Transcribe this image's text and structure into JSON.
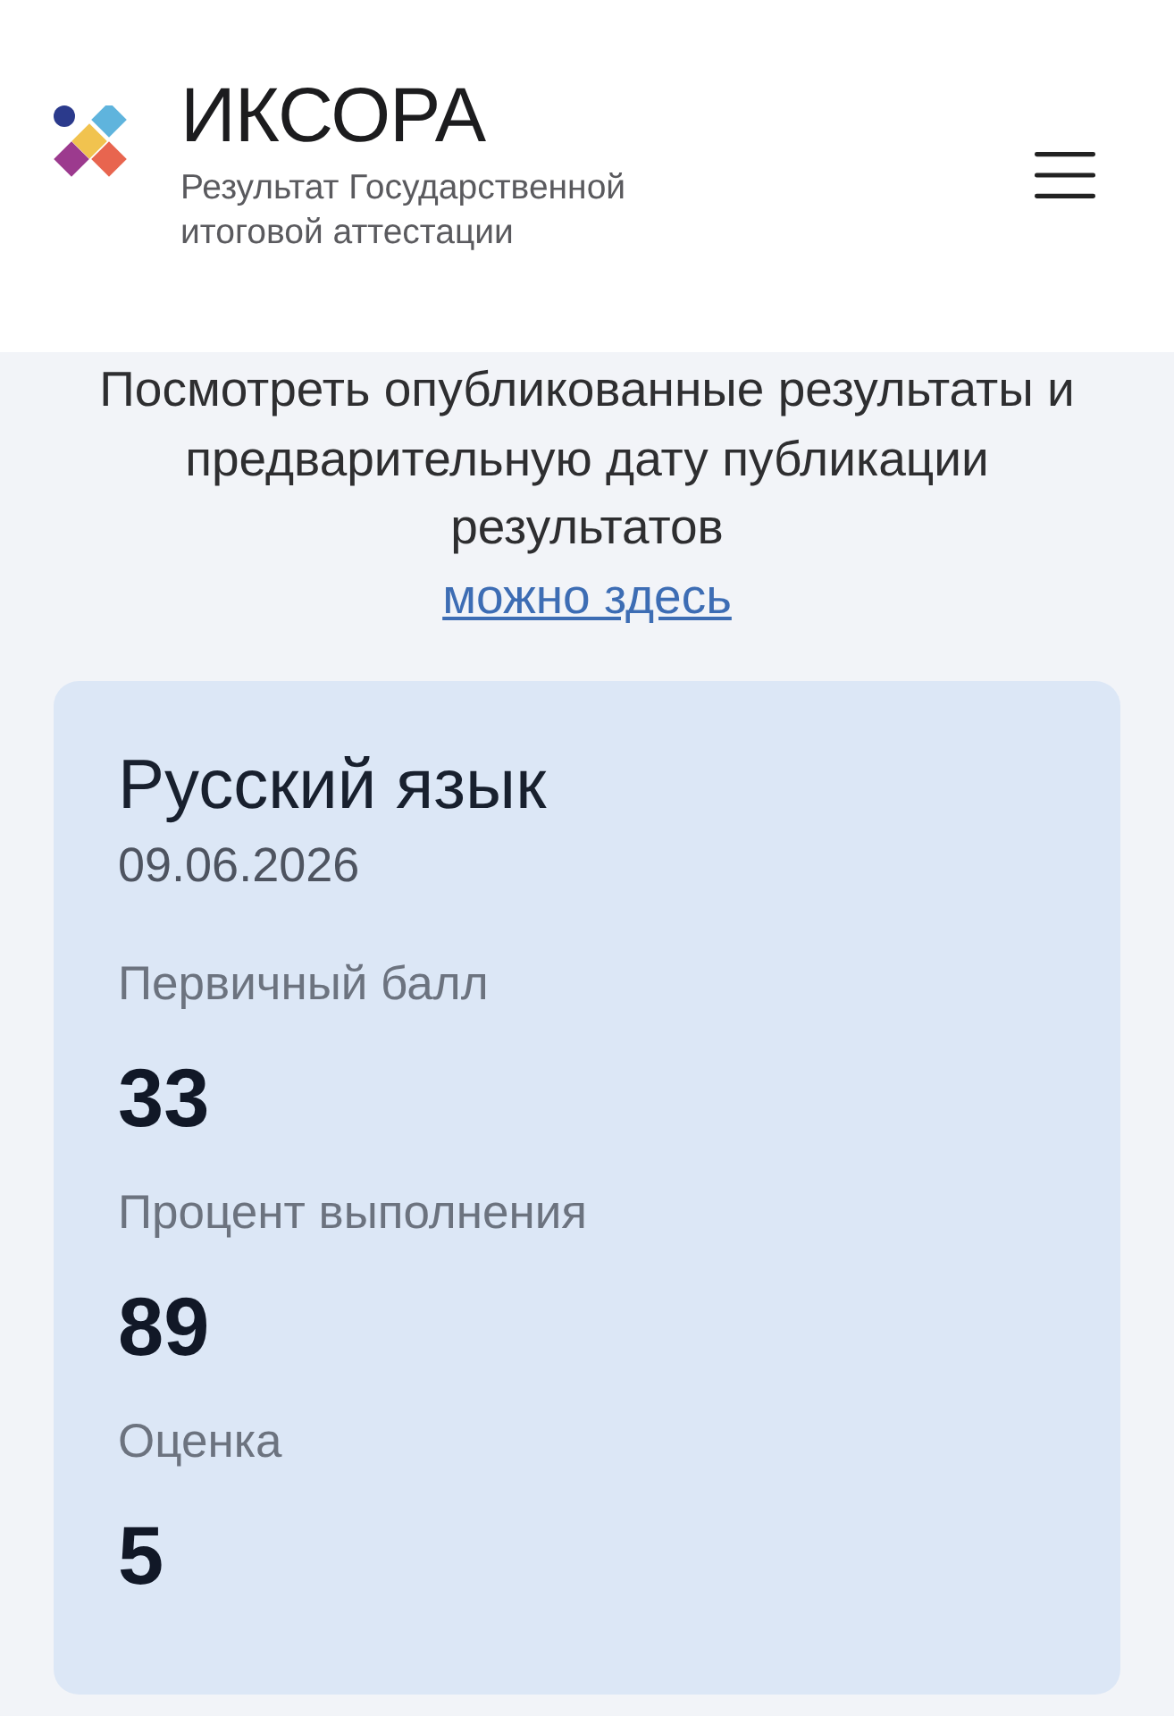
{
  "header": {
    "logo_title": "ИКСОРА",
    "logo_subtitle": "Результат Государственной итоговой аттестации"
  },
  "notice": {
    "text": "Посмотреть опубликованные результаты и предварительную дату публикации результатов",
    "link": "можно здесь"
  },
  "result_card": {
    "subject": "Русский язык",
    "date": "09.06.2026",
    "fields": [
      {
        "label": "Первичный балл",
        "value": "33"
      },
      {
        "label": "Процент выполнения",
        "value": "89"
      },
      {
        "label": "Оценка",
        "value": "5"
      }
    ]
  }
}
